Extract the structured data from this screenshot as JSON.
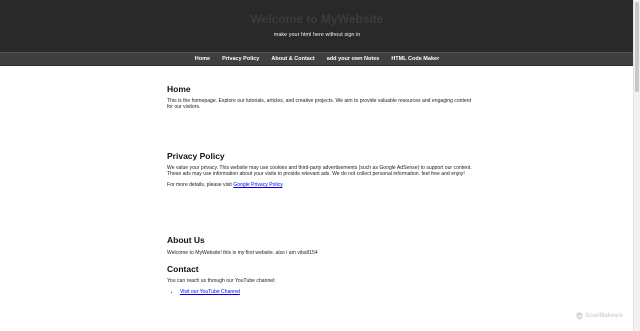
{
  "header": {
    "title": "Welcome to MyWebsite",
    "subtitle": "make your html here without sign in"
  },
  "nav": {
    "items": [
      {
        "label": "Home"
      },
      {
        "label": "Privacy Policy"
      },
      {
        "label": "About & Contact"
      },
      {
        "label": "add your own Notes"
      },
      {
        "label": "HTML Code Maker"
      }
    ]
  },
  "home": {
    "heading": "Home",
    "text": "This is the homepage. Explore our tutorials, articles, and creative projects. We aim to provide valuable resources and engaging content for our visitors."
  },
  "privacy": {
    "heading": "Privacy Policy",
    "text": "We value your privacy. This website may use cookies and third-party advertisements (such as Google AdSense) to support our content. These ads may use information about your visits to provide relevant ads. We do not collect personal information. feel free and enjoy!",
    "more_prefix": "For more details, please visit ",
    "link_label": "Google Privacy Policy",
    "more_suffix": "."
  },
  "about": {
    "heading": "About Us",
    "text": "Welcome to MyWebsite! this is my first website. also i am vibs8154"
  },
  "contact": {
    "heading": "Contact",
    "text": "You can reach us through our YouTube channel:",
    "link_label": "Visit our YouTube Channel"
  },
  "watermark": {
    "label": "ScanMalware",
    "icon": "shield-icon"
  }
}
